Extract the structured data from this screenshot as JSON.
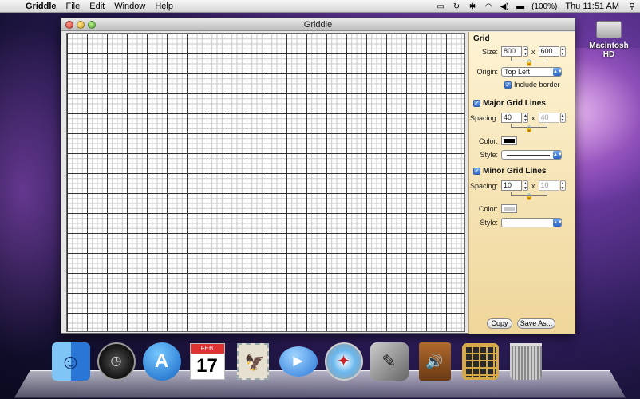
{
  "menubar": {
    "app_name": "Griddle",
    "items": [
      "File",
      "Edit",
      "Window",
      "Help"
    ],
    "battery": "(100%)",
    "clock": "Thu 11:51 AM"
  },
  "desktop": {
    "hd_label": "Macintosh HD"
  },
  "window": {
    "title": "Griddle"
  },
  "panel": {
    "grid": {
      "title": "Grid",
      "size_label": "Size:",
      "width": "800",
      "height": "600",
      "x": "x",
      "origin_label": "Origin:",
      "origin_value": "Top Left",
      "include_border": "Include border"
    },
    "major": {
      "title": "Major Grid Lines",
      "spacing_label": "Spacing:",
      "spacing_x": "40",
      "spacing_y": "40",
      "x": "x",
      "color_label": "Color:",
      "color": "#000000",
      "style_label": "Style:"
    },
    "minor": {
      "title": "Minor Grid Lines",
      "spacing_label": "Spacing:",
      "spacing_x": "10",
      "spacing_y": "10",
      "x": "x",
      "color_label": "Color:",
      "color": "#c8c8c8",
      "style_label": "Style:"
    },
    "buttons": {
      "copy": "Copy",
      "save_as": "Save As..."
    }
  },
  "dock": {
    "ical_month": "FEB",
    "ical_day": "17"
  }
}
